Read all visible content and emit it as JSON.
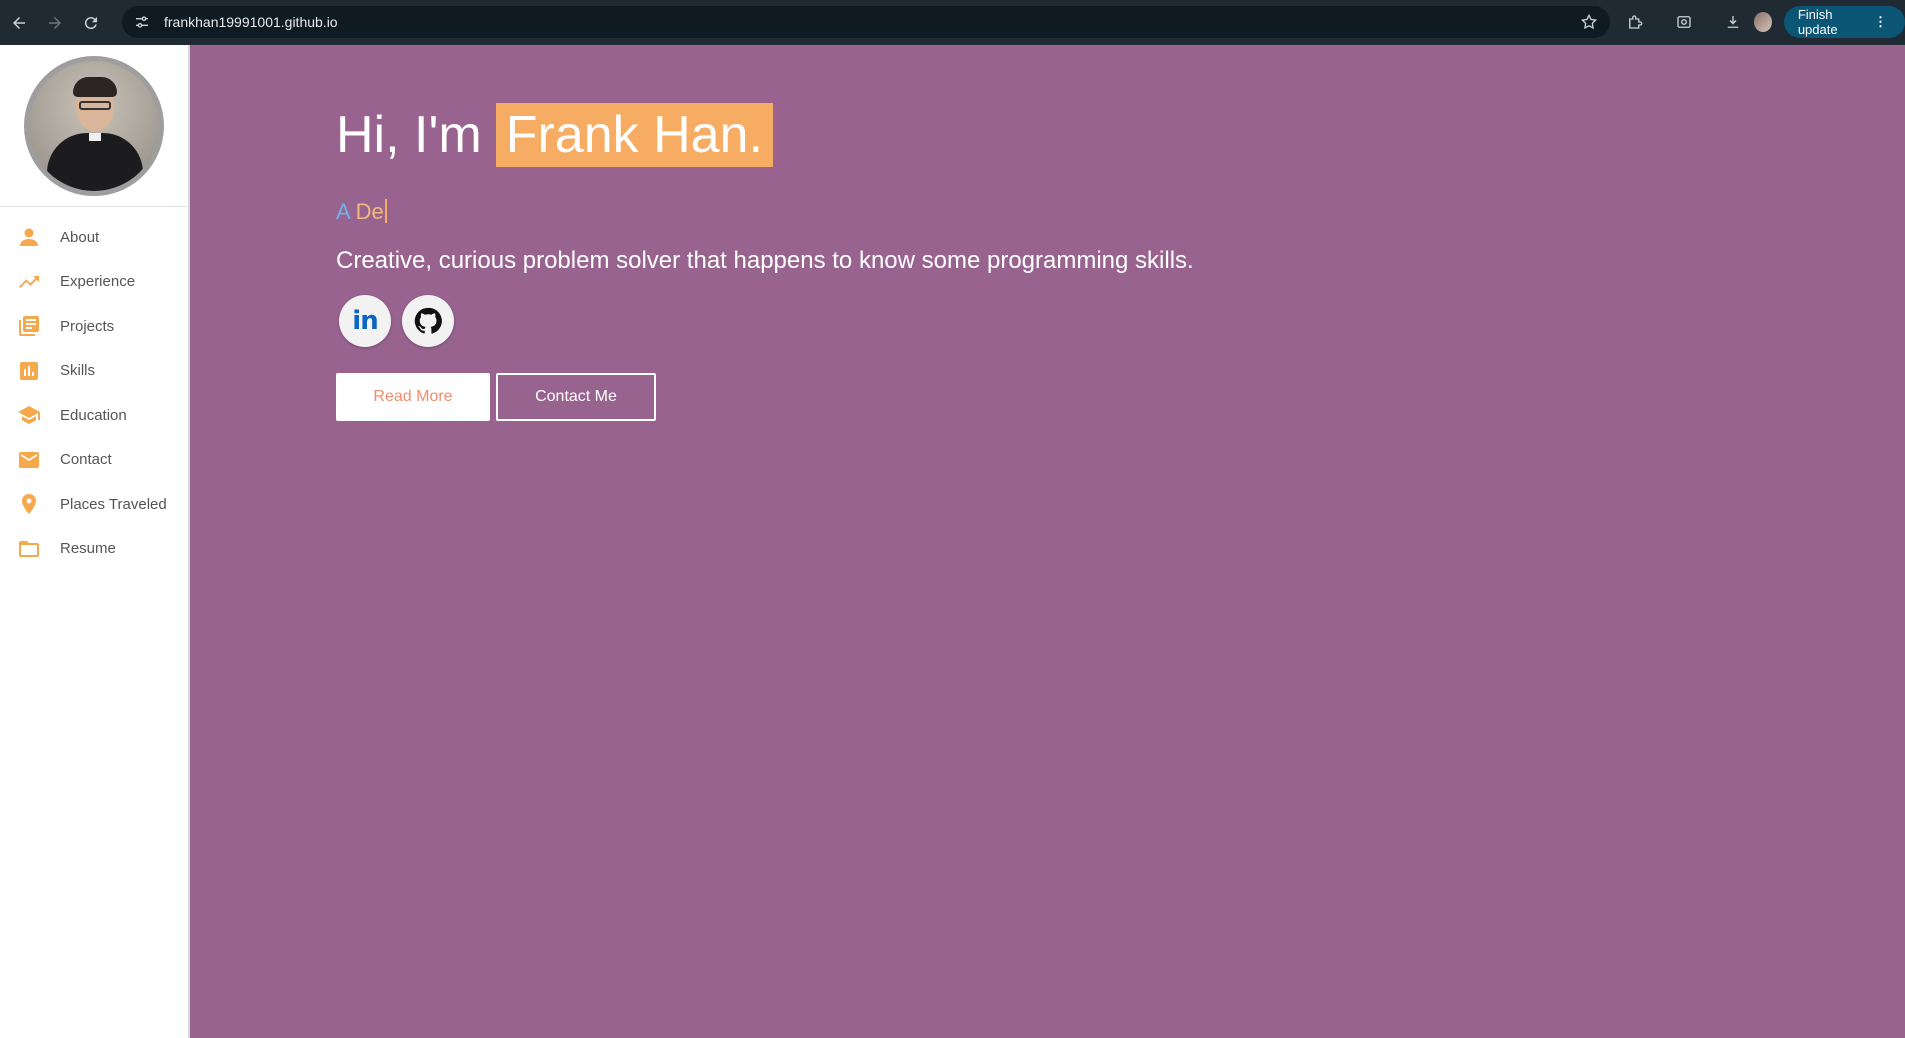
{
  "browser": {
    "url": "frankhan19991001.github.io",
    "finish_update_label": "Finish update",
    "more_label": "⋮"
  },
  "sidebar": {
    "items": [
      {
        "label": "About",
        "icon": "person-icon"
      },
      {
        "label": "Experience",
        "icon": "trending-up-icon"
      },
      {
        "label": "Projects",
        "icon": "library-books-icon"
      },
      {
        "label": "Skills",
        "icon": "bar-chart-icon"
      },
      {
        "label": "Education",
        "icon": "school-icon"
      },
      {
        "label": "Contact",
        "icon": "mail-icon"
      },
      {
        "label": "Places Traveled",
        "icon": "location-pin-icon"
      },
      {
        "label": "Resume",
        "icon": "folder-icon"
      }
    ]
  },
  "hero": {
    "greeting": "Hi, I'm",
    "name": "Frank Han.",
    "typed_part1": "A ",
    "typed_part2": "De",
    "tagline": "Creative, curious problem solver that happens to know some programming skills.",
    "linkedin_label": "in",
    "read_more_label": "Read More",
    "contact_label": "Contact Me"
  },
  "colors": {
    "accent": "#f6ac62",
    "background": "#996390",
    "sidebar_icon": "#f5a94c"
  }
}
